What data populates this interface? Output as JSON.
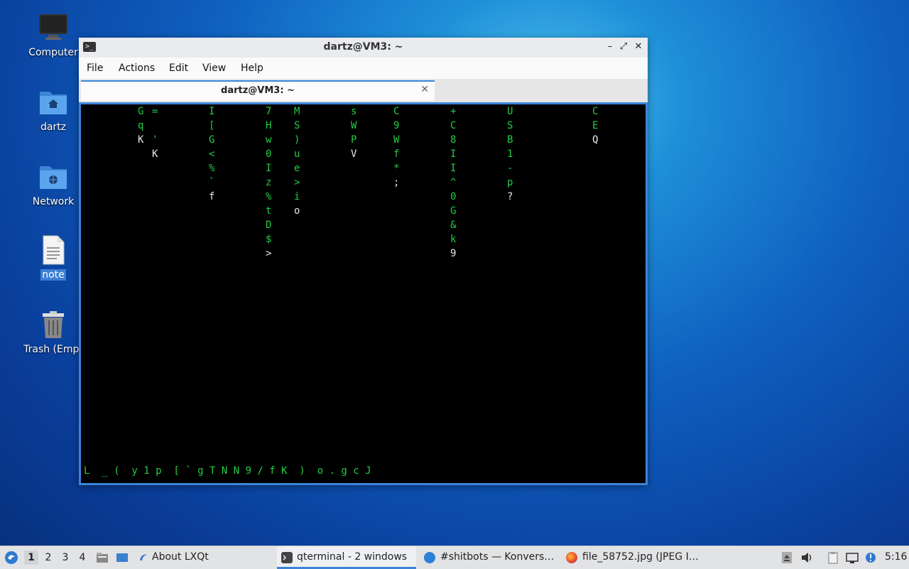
{
  "desktop": {
    "icons": [
      {
        "label": "Computer",
        "icon": "monitor-icon"
      },
      {
        "label": "dartz",
        "icon": "home-folder-icon"
      },
      {
        "label": "Network",
        "icon": "network-folder-icon"
      },
      {
        "label": "note",
        "icon": "text-file-icon"
      },
      {
        "label": "Trash (Empt",
        "icon": "trash-icon"
      }
    ]
  },
  "window": {
    "title": "dartz@VM3: ~",
    "controls": {
      "minimize": "–",
      "maximize": "⤢",
      "close": "✕"
    },
    "menu": [
      "File",
      "Actions",
      "Edit",
      "View",
      "Help"
    ],
    "tab": {
      "label": "dartz@VM3: ~",
      "close": "✕"
    }
  },
  "terminal": {
    "fg_color": "#22cc44",
    "head_color": "#e8e8e8",
    "columns": [
      [
        [
          "G",
          0
        ],
        [
          "q",
          1
        ],
        [
          "K",
          2
        ]
      ],
      [
        [
          "=",
          0
        ],
        [
          "'",
          2
        ],
        [
          "K",
          3
        ]
      ],
      [
        [
          "I",
          0
        ],
        [
          "[",
          1
        ],
        [
          "G",
          2
        ],
        [
          "<",
          3
        ],
        [
          "%",
          4
        ],
        [
          "`",
          5
        ],
        [
          "f",
          6
        ]
      ],
      [
        [
          "7",
          0
        ],
        [
          "H",
          1
        ],
        [
          "w",
          2
        ],
        [
          "0",
          3
        ],
        [
          "I",
          4
        ],
        [
          "z",
          5
        ],
        [
          "%",
          6
        ],
        [
          "t",
          7
        ],
        [
          "D",
          8
        ],
        [
          "$",
          9
        ],
        [
          ">",
          10
        ]
      ],
      [
        [
          "M",
          0
        ],
        [
          "S",
          1
        ],
        [
          ")",
          2
        ],
        [
          "u",
          3
        ],
        [
          "e",
          4
        ],
        [
          ">",
          5
        ],
        [
          "i",
          6
        ],
        [
          "o",
          7
        ]
      ],
      [
        [
          "s",
          0
        ],
        [
          "W",
          1
        ],
        [
          "P",
          2
        ],
        [
          "V",
          3
        ]
      ],
      [
        [
          "C",
          0
        ],
        [
          "9",
          1
        ],
        [
          "W",
          2
        ],
        [
          "f",
          3
        ],
        [
          "*",
          4
        ],
        [
          ";",
          5
        ]
      ],
      [
        [
          "+",
          0
        ],
        [
          "C",
          1
        ],
        [
          "8",
          2
        ],
        [
          "I",
          3
        ],
        [
          "I",
          4
        ],
        [
          "^",
          5
        ],
        [
          "0",
          6
        ],
        [
          "G",
          7
        ],
        [
          "&",
          8
        ],
        [
          "k",
          9
        ],
        [
          "9",
          10
        ]
      ],
      [
        [
          "U",
          0
        ],
        [
          "S",
          1
        ],
        [
          "B",
          2
        ],
        [
          "1",
          3
        ],
        [
          "-",
          4
        ],
        [
          "p",
          5
        ],
        [
          "?",
          6
        ]
      ],
      [
        [
          "C",
          0
        ],
        [
          "E",
          1
        ],
        [
          "Q",
          2
        ]
      ]
    ],
    "bottom_row": "L  _ (  y 1 p  [ ` g T N N 9 / f K  )  o . g c J"
  },
  "taskbar": {
    "workspaces": [
      "1",
      "2",
      "3",
      "4"
    ],
    "tasks": [
      {
        "label": "About LXQt",
        "icon": "lxqt-icon"
      },
      {
        "label": "qterminal - 2 windows",
        "icon": "terminal-icon"
      },
      {
        "label": "#shitbots — Konvers…",
        "icon": "konversation-icon"
      },
      {
        "label": "file_58752.jpg (JPEG I…",
        "icon": "firefox-icon"
      }
    ],
    "clock": "5:16"
  }
}
